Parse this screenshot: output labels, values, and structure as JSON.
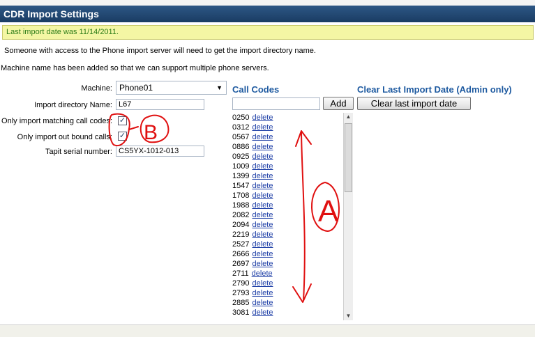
{
  "title": "CDR Import Settings",
  "notice": "Last import date was 11/14/2011.",
  "info": [
    "Someone with access to the Phone import server will need to get the import directory name.",
    "Machine name has been added so that we can support multiple phone servers."
  ],
  "form": {
    "machine_label": "Machine:",
    "machine_value": "Phone01",
    "dir_label": "Import directory Name:",
    "dir_value": "L67",
    "match_label": "Only import matching call codes:",
    "match_checked": "✓",
    "outbound_label": "Only import out bound calls:",
    "outbound_checked": "✓",
    "serial_label": "Tapit serial number:",
    "serial_value": "CS5YX-1012-013"
  },
  "call_codes": {
    "heading": "Call Codes",
    "add_label": "Add",
    "delete_label": "delete",
    "codes": [
      "0250",
      "0312",
      "0567",
      "0886",
      "0925",
      "1009",
      "1399",
      "1547",
      "1708",
      "1988",
      "2082",
      "2094",
      "2219",
      "2527",
      "2666",
      "2697",
      "2711",
      "2790",
      "2793",
      "2885",
      "3081"
    ]
  },
  "clear": {
    "heading": "Clear Last Import Date (Admin only)",
    "button_label": "Clear last import date"
  },
  "annotations": {
    "a_label": "A",
    "b_label": "B",
    "color": "#e01010"
  },
  "colors": {
    "titlebar": "#1a3c63",
    "notice_bg": "#f4f6a4",
    "notice_text": "#2e7d18",
    "heading": "#1e5aa0",
    "link": "#1d3ea6"
  }
}
